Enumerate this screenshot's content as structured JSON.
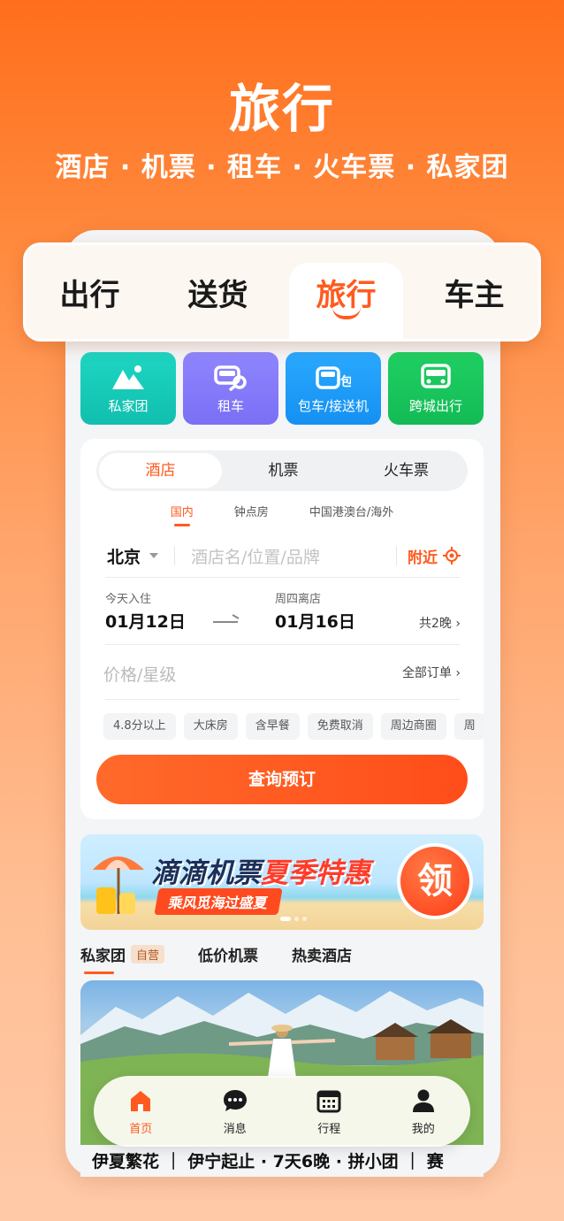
{
  "hero": {
    "title": "旅行",
    "subtitle": "酒店 · 机票 · 租车 · 火车票 · 私家团"
  },
  "main_tabs": [
    {
      "label": "出行",
      "active": false
    },
    {
      "label": "送货",
      "active": false
    },
    {
      "label": "旅行",
      "active": true
    },
    {
      "label": "车主",
      "active": false
    }
  ],
  "services": [
    {
      "label": "私家团",
      "icon": "mountain-icon",
      "color": "#16c9b6"
    },
    {
      "label": "租车",
      "icon": "car-key-icon",
      "color": "#8177fb"
    },
    {
      "label": "包车/接送机",
      "icon": "charter-car-icon",
      "color": "#1f9df8"
    },
    {
      "label": "跨城出行",
      "icon": "intercity-bus-icon",
      "color": "#18c55b"
    }
  ],
  "booking": {
    "segments": [
      {
        "label": "酒店",
        "active": true
      },
      {
        "label": "机票",
        "active": false
      },
      {
        "label": "火车票",
        "active": false
      }
    ],
    "subtabs": [
      {
        "label": "国内",
        "active": true
      },
      {
        "label": "钟点房",
        "active": false
      },
      {
        "label": "中国港澳台/海外",
        "active": false
      }
    ],
    "city": "北京",
    "search_placeholder": "酒店名/位置/品牌",
    "nearby_label": "附近",
    "checkin_label": "今天入住",
    "checkin_date": "01月12日",
    "checkout_label": "周四离店",
    "checkout_date": "01月16日",
    "nights": "共2晚",
    "price_placeholder": "价格/星级",
    "orders_link": "全部订单",
    "chips": [
      "4.8分以上",
      "大床房",
      "含早餐",
      "免费取消",
      "周边商圈",
      "周"
    ],
    "cta_label": "查询预订"
  },
  "banner": {
    "title_main": "滴滴机票",
    "title_highlight": "夏季特惠",
    "ribbon": "乘风觅海过盛夏",
    "claim": "领"
  },
  "content_tabs": [
    {
      "label": "私家团",
      "badge": "自营",
      "active": true
    },
    {
      "label": "低价机票",
      "badge": "",
      "active": false
    },
    {
      "label": "热卖酒店",
      "badge": "",
      "active": false
    }
  ],
  "feature": {
    "caption": "伊夏繁花 ｜ 伊宁起止 · 7天6晚 · 拼小团 ｜ 赛"
  },
  "bottom_nav": [
    {
      "label": "首页",
      "icon": "home-icon",
      "active": true
    },
    {
      "label": "消息",
      "icon": "chat-icon",
      "active": false
    },
    {
      "label": "行程",
      "icon": "calendar-icon",
      "active": false
    },
    {
      "label": "我的",
      "icon": "profile-icon",
      "active": false
    }
  ],
  "colors": {
    "accent": "#ff5a1f",
    "background_top": "#ff6e1c",
    "background_bottom": "#ffc9a8"
  }
}
